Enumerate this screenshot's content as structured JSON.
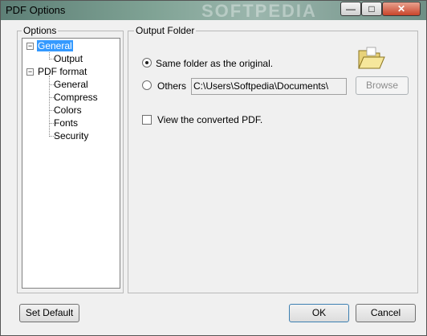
{
  "window": {
    "title": "PDF Options",
    "watermark": "SOFTPEDIA"
  },
  "controls": {
    "minimize": "—",
    "maximize": "□",
    "close": "✕"
  },
  "options": {
    "legend": "Options",
    "tree": [
      {
        "label": "General",
        "expander": "−"
      },
      {
        "label": "Output"
      },
      {
        "label": "PDF format",
        "expander": "−"
      },
      {
        "label": "General"
      },
      {
        "label": "Compress"
      },
      {
        "label": "Colors"
      },
      {
        "label": "Fonts"
      },
      {
        "label": "Security"
      }
    ]
  },
  "output_folder": {
    "legend": "Output Folder",
    "same_folder_label": "Same folder as the original.",
    "others_label": "Others",
    "path_value": "C:\\Users\\Softpedia\\Documents\\",
    "browse_label": "Browse",
    "view_pdf_label": "View the converted PDF."
  },
  "buttons": {
    "set_default": "Set Default",
    "ok": "OK",
    "cancel": "Cancel"
  },
  "icons": {
    "folder": "open-folder-icon"
  }
}
